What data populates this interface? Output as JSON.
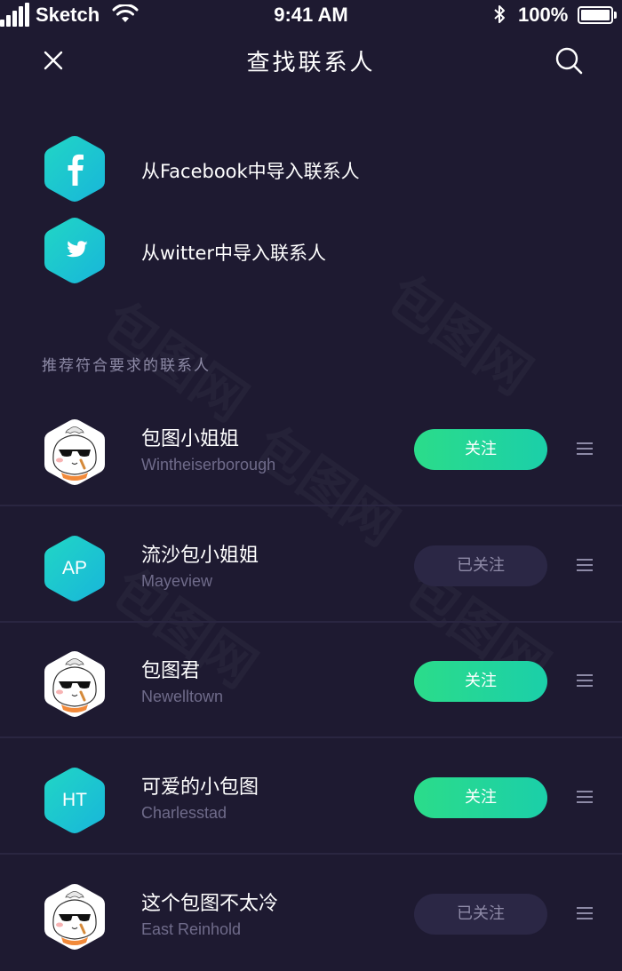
{
  "status_bar": {
    "carrier": "Sketch",
    "time": "9:41 AM",
    "battery": "100%"
  },
  "nav": {
    "title": "查找联系人",
    "close_icon": "close-icon",
    "search_icon": "search-icon"
  },
  "import": [
    {
      "label": "从Facebook中导入联系人",
      "icon": "facebook-icon"
    },
    {
      "label": "从witter中导入联系人",
      "icon": "twitter-icon"
    }
  ],
  "section_title": "推荐符合要求的联系人",
  "contacts": [
    {
      "name": "包图小姐姐",
      "location": "Wintheiserborough",
      "avatar": "bun-mascot-avatar",
      "button": "关注",
      "followed": false
    },
    {
      "name": "流沙包小姐姐",
      "location": "Mayeview",
      "initials": "AP",
      "button": "已关注",
      "followed": true
    },
    {
      "name": "包图君",
      "location": "Newelltown",
      "avatar": "bun-mascot-avatar",
      "button": "关注",
      "followed": false
    },
    {
      "name": "可爱的小包图",
      "location": "Charlesstad",
      "initials": "HT",
      "button": "关注",
      "followed": false
    },
    {
      "name": "这个包图不太冷",
      "location": "East Reinhold",
      "avatar": "bun-mascot-avatar",
      "button": "已关注",
      "followed": true
    }
  ],
  "watermark": "包图网",
  "colors": {
    "background": "#1e1a31",
    "accent_start": "#2bdc8a",
    "accent_end": "#1bcfa9",
    "hex_start": "#1fd0c9",
    "hex_end": "#19b8d8",
    "muted_text": "#6f6b8a"
  }
}
